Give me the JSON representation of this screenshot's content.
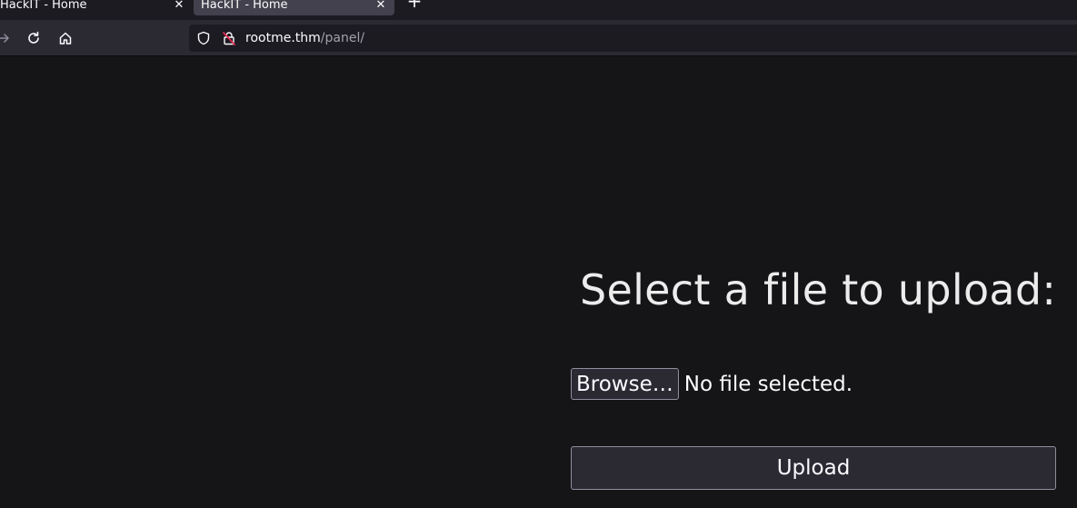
{
  "browser": {
    "tabs": [
      {
        "title": "HackIT - Home",
        "active": false
      },
      {
        "title": "HackIT - Home",
        "active": true
      }
    ],
    "new_tab_icon": "plus-icon",
    "url": {
      "host": "rootme.thm",
      "path": "/panel/"
    }
  },
  "page": {
    "heading": "Select a file to upload:",
    "browse_label": "Browse…",
    "file_status": "No file selected.",
    "upload_label": "Upload"
  },
  "colors": {
    "background": "#151518",
    "toolbar": "#2b2a33",
    "text": "#fbfbfe",
    "insecure_indicator": "#e22850"
  }
}
